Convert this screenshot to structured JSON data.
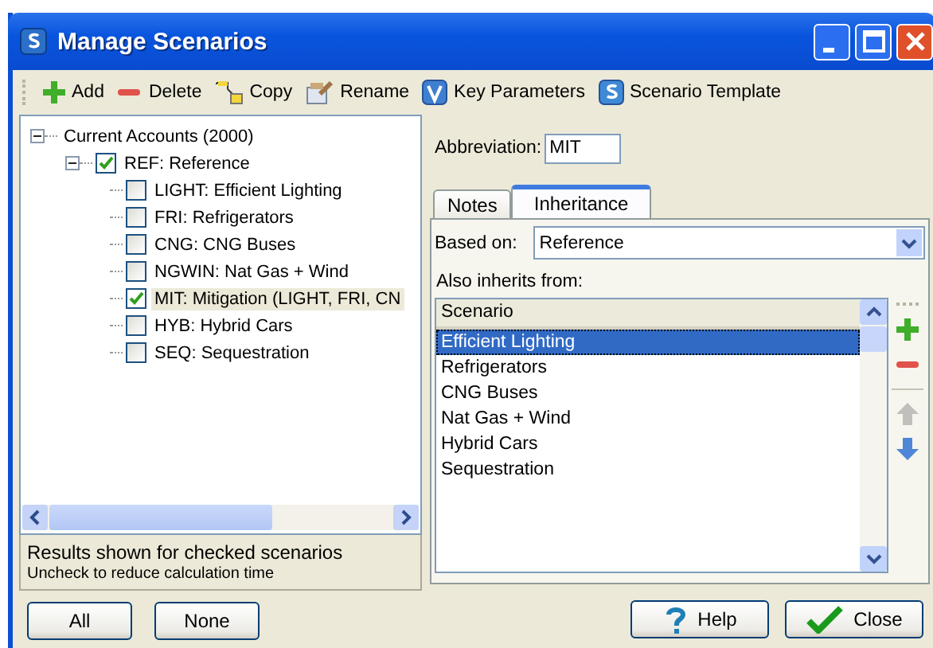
{
  "window": {
    "title": "Manage Scenarios"
  },
  "toolbar": [
    {
      "kind": "add",
      "label": "Add"
    },
    {
      "kind": "delete",
      "label": "Delete"
    },
    {
      "kind": "copy",
      "label": "Copy"
    },
    {
      "kind": "rename",
      "label": "Rename"
    },
    {
      "kind": "key",
      "label": "Key Parameters"
    },
    {
      "kind": "template",
      "label": "Scenario Template"
    }
  ],
  "tree": [
    {
      "label": "Current Accounts (2000)",
      "expanded": true,
      "children": [
        {
          "label": "REF: Reference",
          "checked": true,
          "selected": false,
          "expanded": true,
          "children": [
            {
              "label": "LIGHT: Efficient Lighting",
              "checked": false,
              "selected": false
            },
            {
              "label": "FRI: Refrigerators",
              "checked": false,
              "selected": false
            },
            {
              "label": "CNG: CNG Buses",
              "checked": false,
              "selected": false
            },
            {
              "label": "NGWIN: Nat Gas + Wind",
              "checked": false,
              "selected": false
            },
            {
              "label": "MIT: Mitigation (LIGHT, FRI, CN",
              "checked": true,
              "selected": true
            },
            {
              "label": "HYB: Hybrid Cars",
              "checked": false,
              "selected": false
            },
            {
              "label": "SEQ: Sequestration",
              "checked": false,
              "selected": false
            }
          ]
        }
      ]
    }
  ],
  "tree_info": {
    "title": "Results shown for checked scenarios",
    "hint": "Uncheck to reduce calculation time"
  },
  "left_buttons": [
    "All",
    "None"
  ],
  "abbreviation": {
    "label": "Abbreviation:",
    "value": "MIT"
  },
  "tabs": [
    {
      "label": "Notes",
      "selected": false
    },
    {
      "label": "Inheritance",
      "selected": true
    }
  ],
  "based_on": {
    "label": "Based on:",
    "value": "Reference"
  },
  "also_inherits": {
    "label": "Also inherits from:",
    "column": "Scenario",
    "rows": [
      {
        "label": "Efficient Lighting",
        "selected": true
      },
      {
        "label": "Refrigerators",
        "selected": false
      },
      {
        "label": "CNG Buses",
        "selected": false
      },
      {
        "label": "Nat Gas + Wind",
        "selected": false
      },
      {
        "label": "Hybrid Cars",
        "selected": false
      },
      {
        "label": "Sequestration",
        "selected": false
      }
    ]
  },
  "side_tools": [
    {
      "kind": "add",
      "disabled": false
    },
    {
      "kind": "remove",
      "disabled": false
    },
    {
      "kind": "up",
      "disabled": true
    },
    {
      "kind": "down",
      "disabled": false
    }
  ],
  "buttons": [
    {
      "kind": "help",
      "label": "Help"
    },
    {
      "kind": "close",
      "label": "Close"
    }
  ]
}
